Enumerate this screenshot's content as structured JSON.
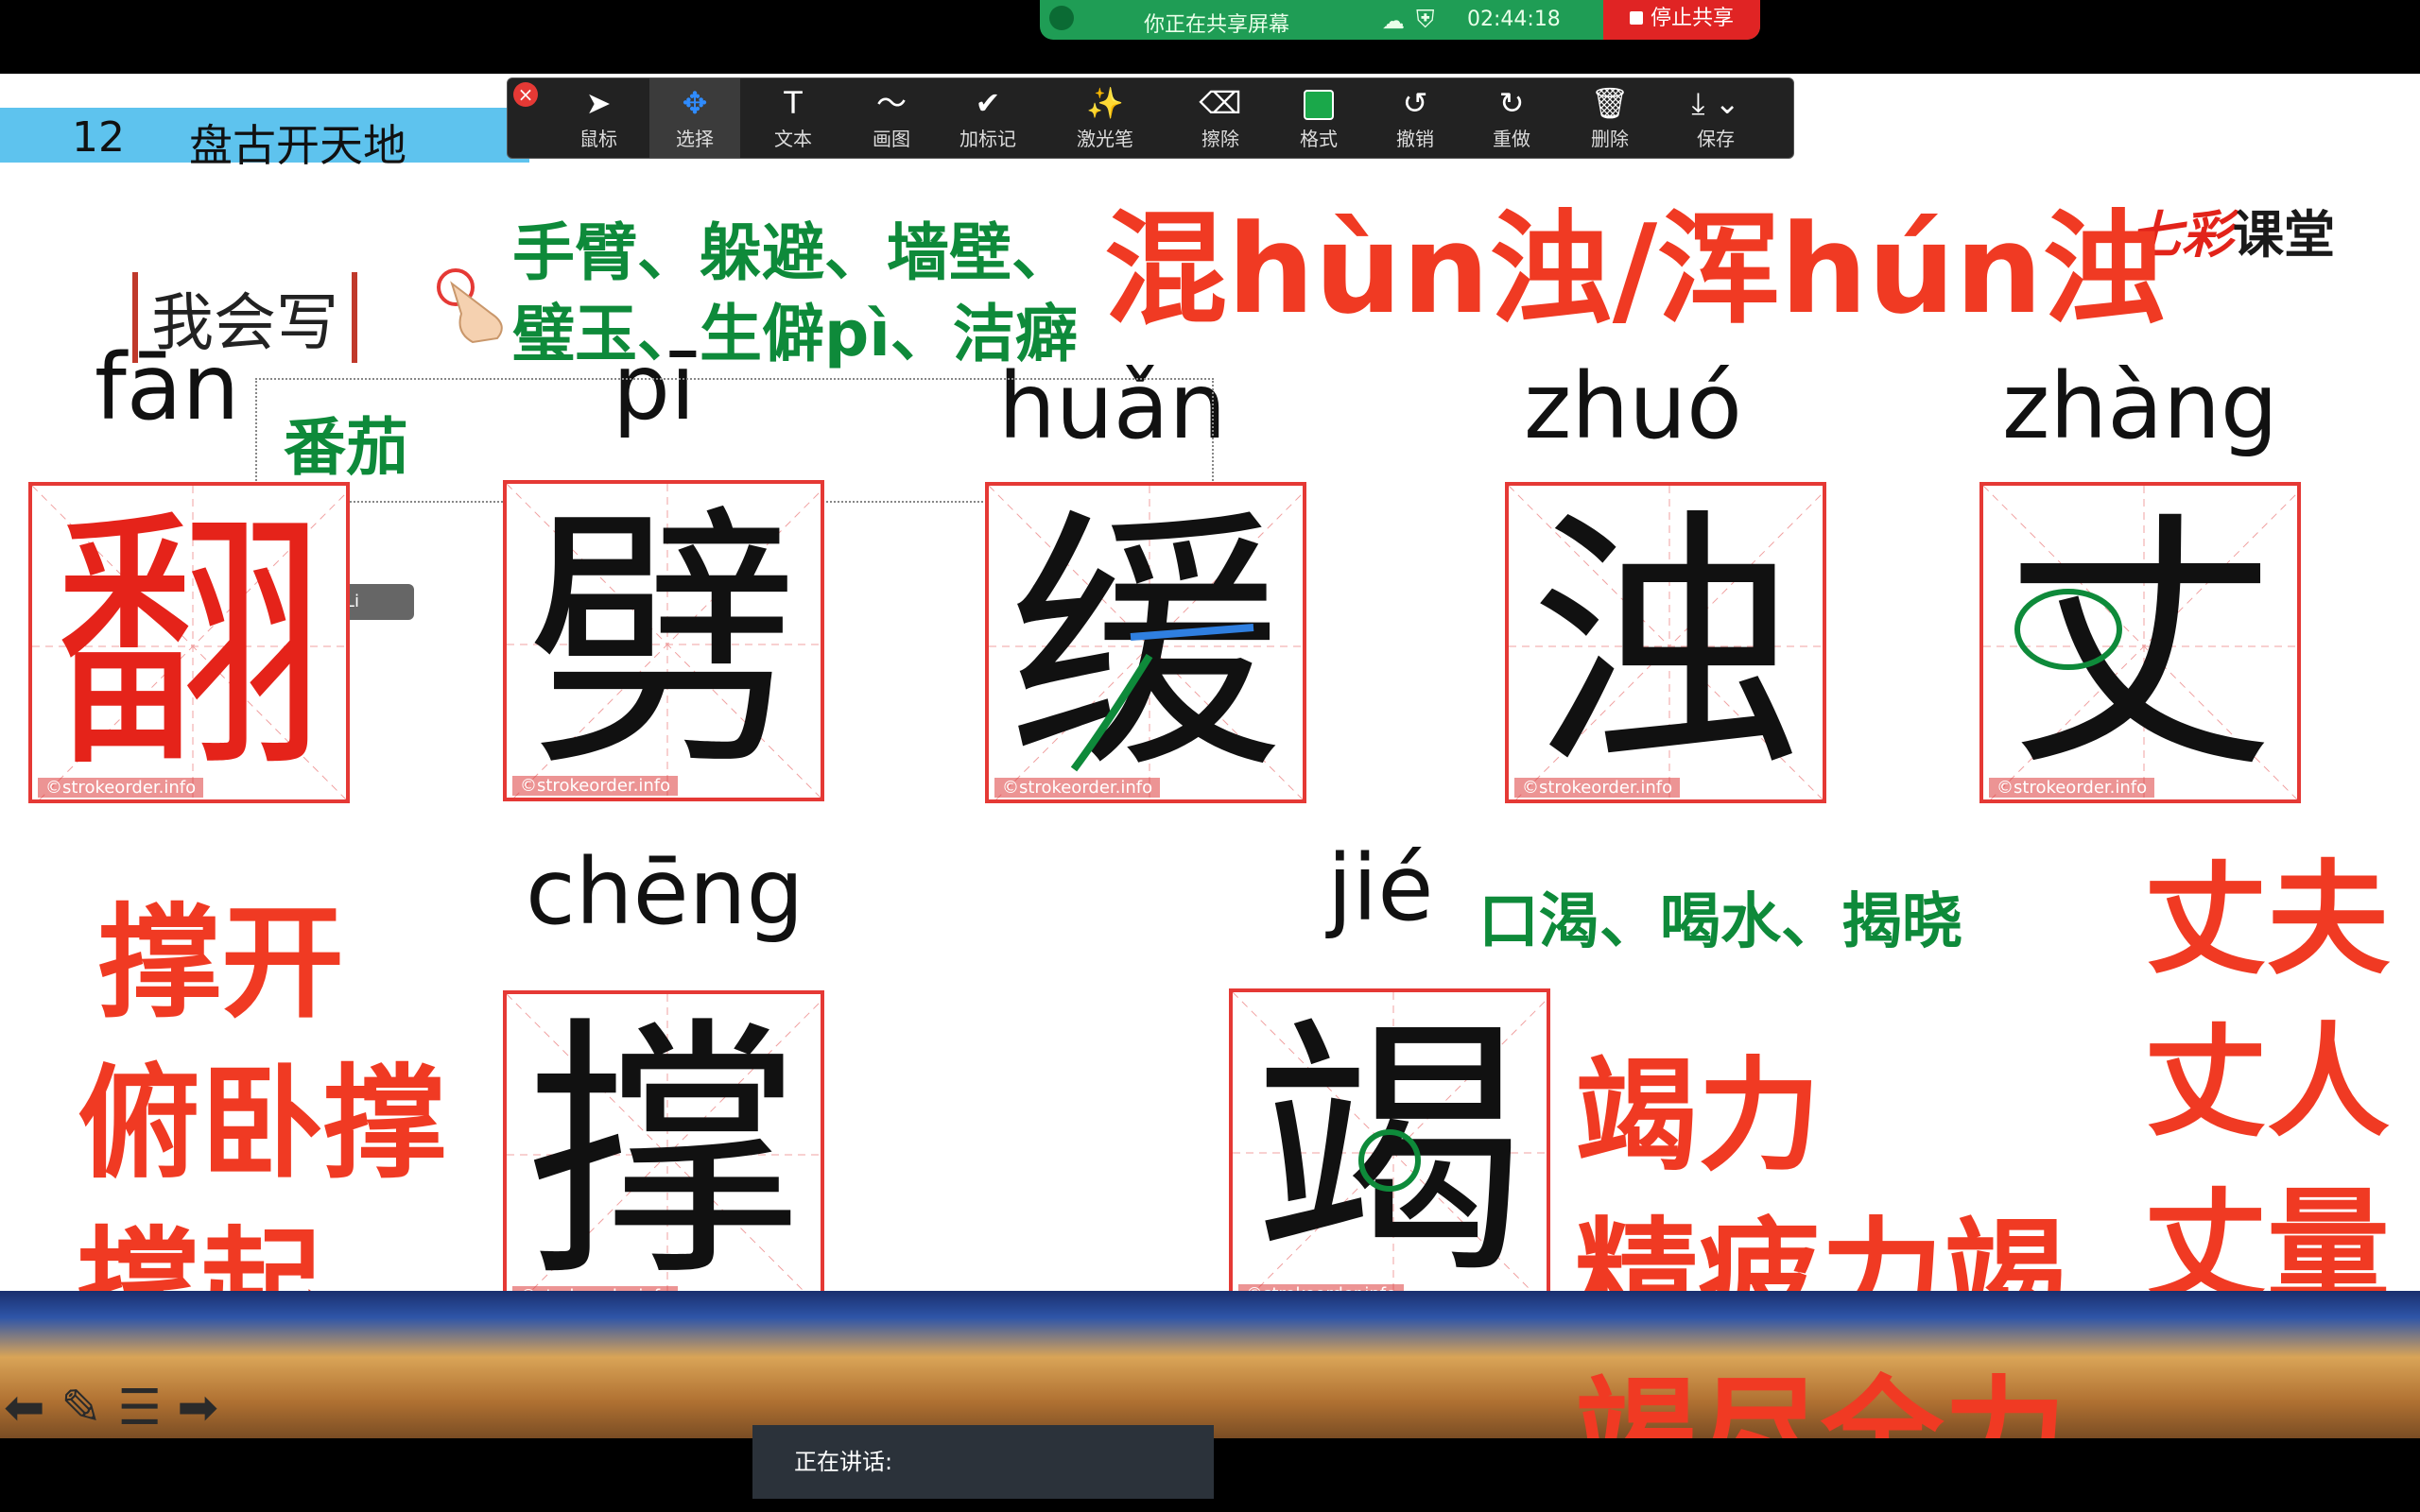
{
  "share_bar": {
    "status": "你正在共享屏幕",
    "timer": "02:44:18",
    "stop_label": "停止共享"
  },
  "lesson": {
    "number": "12",
    "title": "盘古开天地"
  },
  "toolbar": {
    "items": [
      {
        "icon": "cursor-icon",
        "label": "鼠标"
      },
      {
        "icon": "move-icon",
        "label": "选择"
      },
      {
        "icon": "text-icon",
        "label": "文本"
      },
      {
        "icon": "draw-icon",
        "label": "画图"
      },
      {
        "icon": "checkmark-icon",
        "label": "加标记"
      },
      {
        "icon": "laser-icon",
        "label": "激光笔"
      },
      {
        "icon": "eraser-icon",
        "label": "擦除"
      },
      {
        "icon": "format-icon",
        "label": "格式"
      },
      {
        "icon": "undo-icon",
        "label": "撤销"
      },
      {
        "icon": "redo-icon",
        "label": "重做"
      },
      {
        "icon": "trash-icon",
        "label": "删除"
      },
      {
        "icon": "save-icon",
        "label": "保存"
      }
    ]
  },
  "logo": {
    "part1": "七彩",
    "part2": "课堂"
  },
  "section_title": "我会写",
  "notes": {
    "green_line1": "手臂、躲避、墙壁、",
    "green_line2": "璧玉、生僻pì、洁癖",
    "red_top": "混hùn浊/浑hún浊",
    "fan_word": "番茄",
    "qili": "Qi Li",
    "cheng_words": [
      "撑开",
      "俯卧撑",
      "撑起"
    ],
    "jie_green": "口渴、喝水、揭晓",
    "jie_words": [
      "竭力",
      "精疲力竭",
      "竭尽全力"
    ],
    "zhang_words": [
      "丈夫",
      "丈人",
      "丈量"
    ]
  },
  "characters": [
    {
      "pinyin": "fān",
      "char": "翻"
    },
    {
      "pinyin": "pī",
      "char": "劈"
    },
    {
      "pinyin": "huǎn",
      "char": "缓"
    },
    {
      "pinyin": "zhuó",
      "char": "浊"
    },
    {
      "pinyin": "zhàng",
      "char": "丈"
    },
    {
      "pinyin": "chēng",
      "char": "撑"
    },
    {
      "pinyin": "jié",
      "char": "竭"
    }
  ],
  "watermark": "©strokeorder.info",
  "speaking_label": "正在讲话:",
  "colors": {
    "accent_red": "#f03a23",
    "accent_green": "#0e8a3a",
    "share_green": "#1f9d55"
  }
}
